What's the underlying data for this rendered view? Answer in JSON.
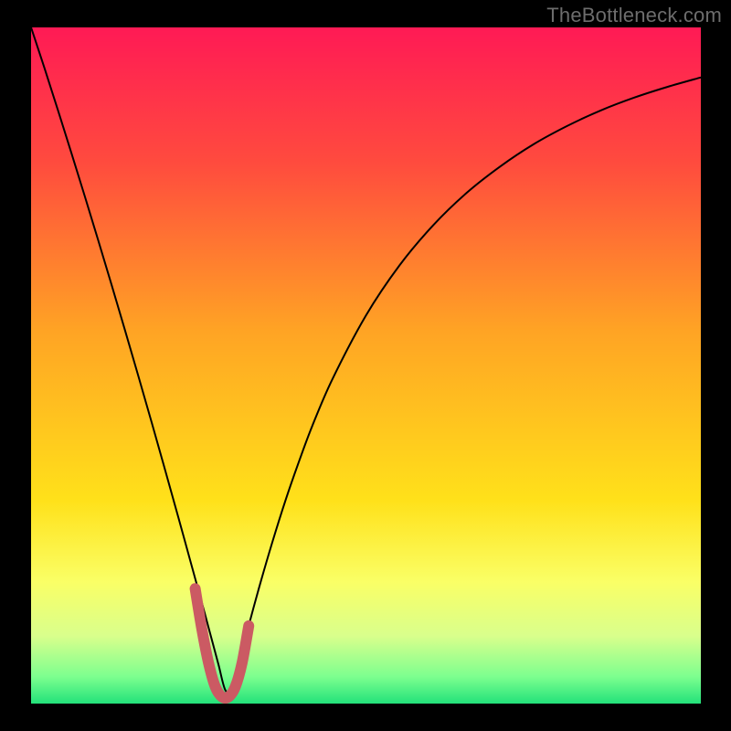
{
  "watermark": "TheBottleneck.com",
  "chart_data": {
    "type": "line",
    "title": "",
    "xlabel": "",
    "ylabel": "",
    "xlim": [
      0,
      100
    ],
    "ylim": [
      0,
      100
    ],
    "background_gradient": {
      "type": "vertical",
      "stops": [
        {
          "pos": 0.0,
          "color": "#ff1a55"
        },
        {
          "pos": 0.2,
          "color": "#ff4b3e"
        },
        {
          "pos": 0.45,
          "color": "#ffa424"
        },
        {
          "pos": 0.7,
          "color": "#ffe11a"
        },
        {
          "pos": 0.82,
          "color": "#faff66"
        },
        {
          "pos": 0.9,
          "color": "#d9ff8c"
        },
        {
          "pos": 0.96,
          "color": "#7dff8f"
        },
        {
          "pos": 1.0,
          "color": "#23e27a"
        }
      ]
    },
    "series": [
      {
        "name": "bottleneck-curve",
        "color": "#000000",
        "stroke_width": 2,
        "x": [
          0,
          2,
          4,
          6,
          8,
          10,
          12,
          14,
          16,
          18,
          20,
          22,
          24,
          25,
          26,
          27,
          28,
          29,
          30,
          31,
          32,
          34,
          36,
          38,
          40,
          42,
          45,
          50,
          55,
          60,
          65,
          70,
          75,
          80,
          85,
          90,
          95,
          100
        ],
        "y": [
          100,
          94.0,
          87.8,
          81.5,
          75.1,
          68.6,
          62.0,
          55.3,
          48.5,
          41.6,
          34.6,
          27.5,
          20.3,
          16.7,
          13.1,
          9.4,
          5.7,
          2.0,
          2.0,
          5.9,
          9.7,
          17.0,
          23.8,
          30.1,
          35.8,
          41.1,
          48.0,
          57.4,
          64.8,
          70.7,
          75.5,
          79.4,
          82.7,
          85.4,
          87.7,
          89.6,
          91.2,
          92.6
        ]
      },
      {
        "name": "sweet-spot-marker",
        "color": "#cb5a63",
        "stroke_width": 12,
        "linecap": "round",
        "x": [
          24.5,
          25.5,
          26.5,
          27.5,
          28.5,
          29.5,
          30.5,
          31.5,
          32.5
        ],
        "y": [
          17.0,
          11.0,
          6.0,
          2.5,
          1.0,
          1.0,
          2.5,
          6.0,
          11.5
        ]
      }
    ]
  }
}
